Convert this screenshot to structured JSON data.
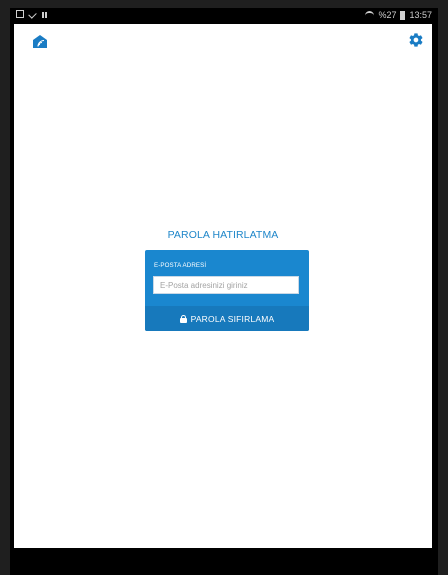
{
  "status_bar": {
    "signal": "%27",
    "time": "13:57"
  },
  "icons": {
    "logo": "home-wifi-icon",
    "settings": "gear-icon",
    "lock": "lock-icon"
  },
  "form": {
    "title": "PAROLA HATIRLATMA",
    "email_label": "E-POSTA ADRESİ",
    "email_placeholder": "E-Posta adresinizi giriniz",
    "email_value": "",
    "reset_label": "PAROLA SIFIRLAMA"
  },
  "colors": {
    "accent": "#1a87cf",
    "button": "#1779bc",
    "title": "#1e86c9"
  }
}
